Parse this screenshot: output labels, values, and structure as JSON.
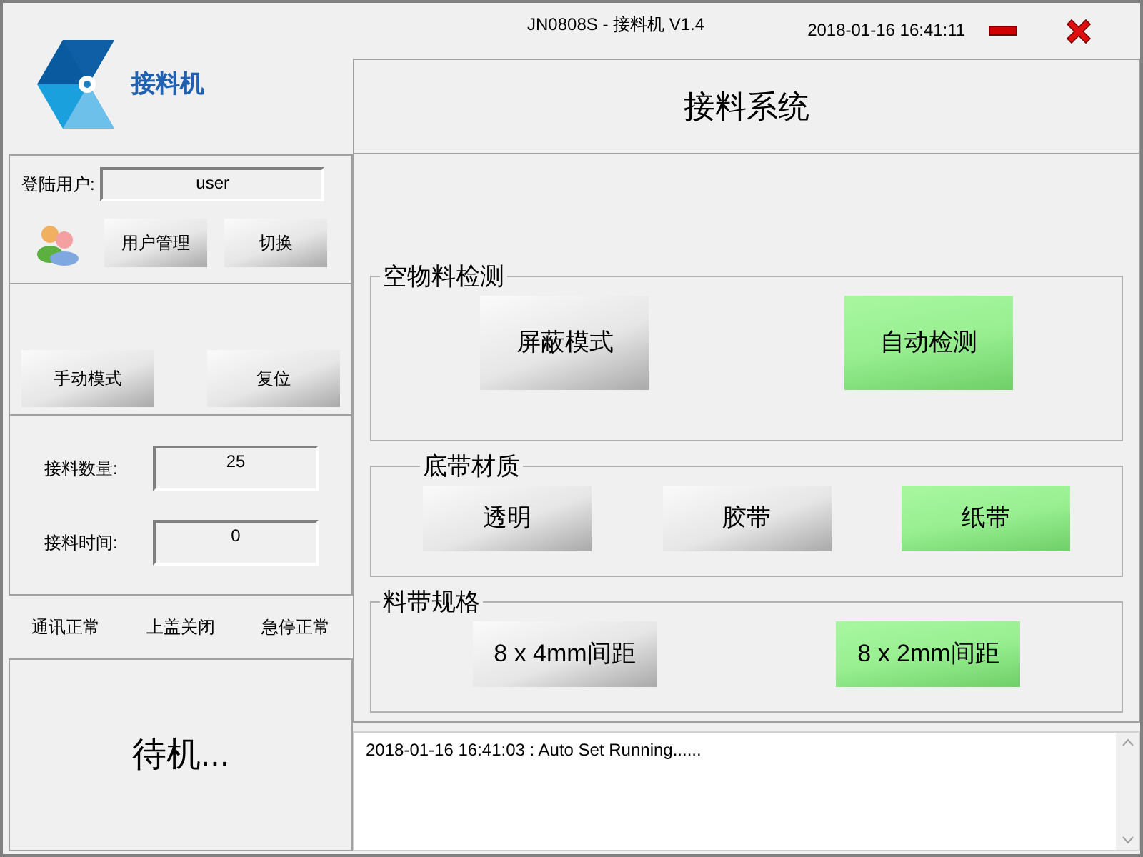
{
  "window": {
    "title": "JN0808S - 接料机 V1.4",
    "datetime": "2018-01-16  16:41:11"
  },
  "logo": {
    "name": "接料机"
  },
  "header": {
    "title": "接料系统"
  },
  "user": {
    "label": "登陆用户:",
    "value": "user",
    "buttons": [
      "用户管理",
      "切换"
    ]
  },
  "mode_buttons": [
    "手动模式",
    "复位"
  ],
  "counters": [
    {
      "label": "接料数量:",
      "value": "25"
    },
    {
      "label": "接料时间:",
      "value": "0"
    }
  ],
  "status": [
    "通讯正常",
    "上盖关闭",
    "急停正常"
  ],
  "state_text": "待机...",
  "groups": [
    {
      "title": "空物料检测",
      "options": [
        {
          "label": "屏蔽模式",
          "selected": false
        },
        {
          "label": "自动检测",
          "selected": true
        }
      ]
    },
    {
      "title": "底带材质",
      "options": [
        {
          "label": "透明",
          "selected": false
        },
        {
          "label": "胶带",
          "selected": false
        },
        {
          "label": "纸带",
          "selected": true
        }
      ]
    },
    {
      "title": "料带规格",
      "options": [
        {
          "label": "8 x 4mm间距",
          "selected": false
        },
        {
          "label": "8 x 2mm间距",
          "selected": true
        }
      ]
    }
  ],
  "log": [
    "2018-01-16  16:41:03  :   Auto Set Running......"
  ]
}
